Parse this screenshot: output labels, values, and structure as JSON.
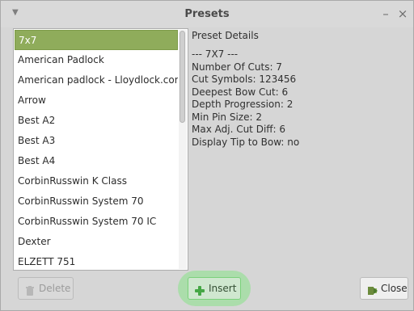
{
  "window": {
    "title": "Presets"
  },
  "preset_list": {
    "items": [
      "7x7",
      "American Padlock",
      "American padlock - Lloydlock.com",
      "Arrow",
      "Best A2",
      "Best A3",
      "Best A4",
      "CorbinRusswin K Class",
      "CorbinRusswin System 70",
      "CorbinRusswin System 70 IC",
      "Dexter",
      "ELZETT 751"
    ],
    "selected": "7x7"
  },
  "details": {
    "heading": "Preset Details",
    "lines": [
      "--- 7X7 ---",
      "Number Of Cuts: 7",
      "Cut Symbols: 123456",
      "Deepest Bow Cut: 6",
      "Depth Progression: 2",
      "Min Pin Size: 2",
      "Max Adj. Cut Diff: 6",
      "Display Tip to Bow: no"
    ]
  },
  "buttons": {
    "delete_label": "Delete",
    "insert_label": "Insert",
    "close_label": "Close"
  },
  "icons": {
    "window_menu": "chevron-down-icon",
    "minimize": "minimize-icon",
    "close": "close-icon",
    "delete": "trash-icon",
    "insert": "plus-icon",
    "close_button": "exit-icon"
  },
  "colors": {
    "selected_item": "#8fac5b",
    "insert_highlight": "#78e678",
    "window_bg": "#d6d6d6"
  }
}
